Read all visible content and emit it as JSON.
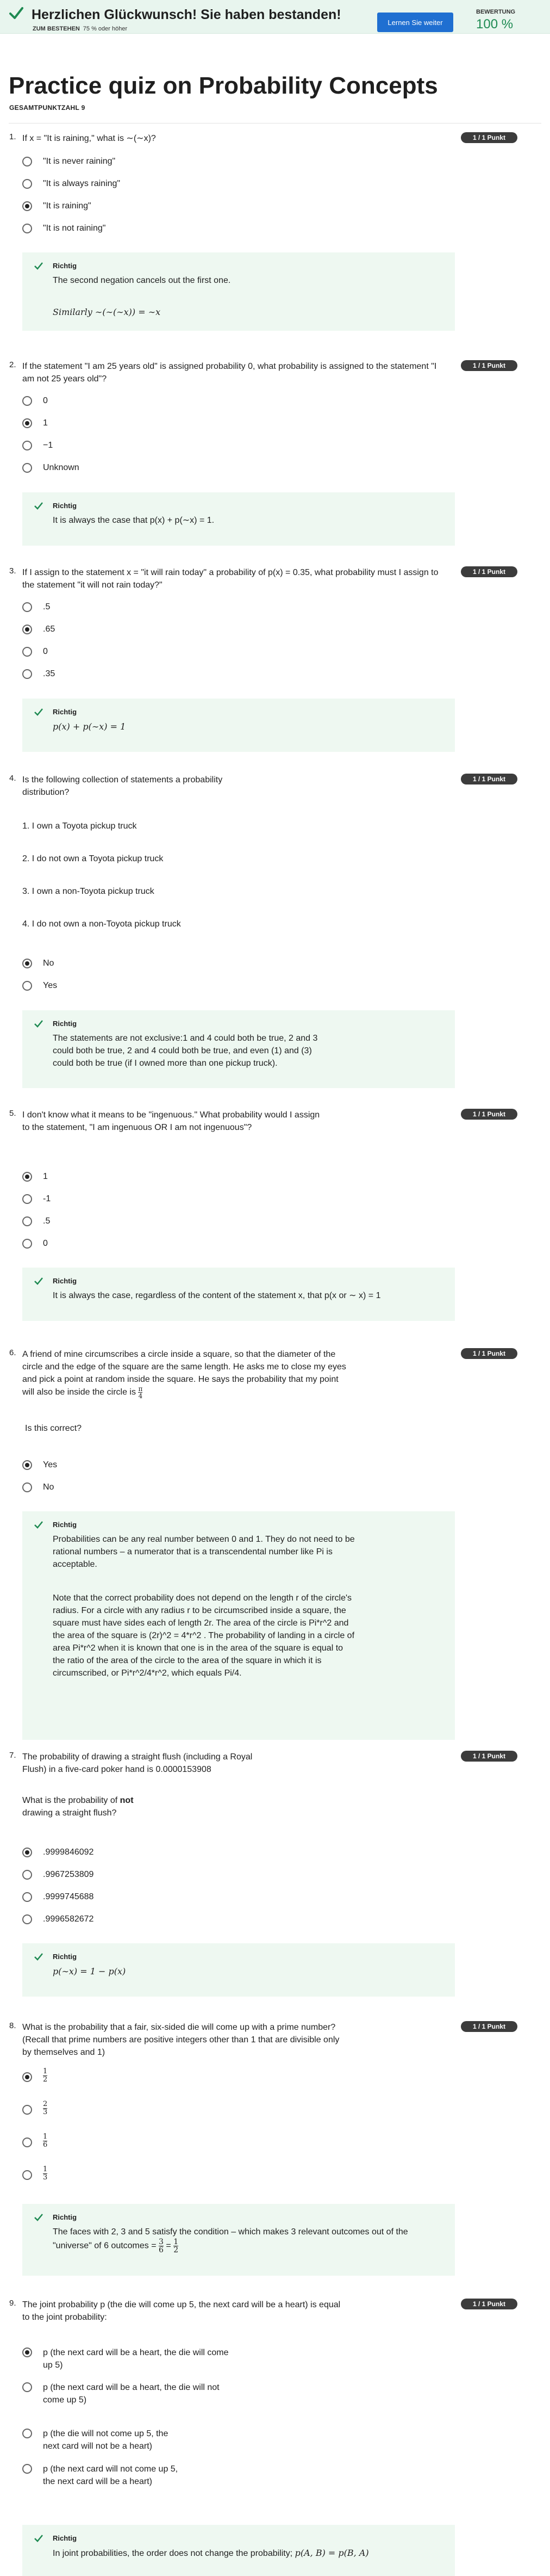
{
  "banner": {
    "title": "Herzlichen Glückwunsch! Sie haben bestanden!",
    "pass_label": "ZUM BESTEHEN",
    "pass_value": "75 % oder höher",
    "learn_button": "Lernen Sie weiter",
    "grade_label": "BEWERTUNG",
    "grade_value": "100 %"
  },
  "page": {
    "title": "Practice quiz on Probability Concepts",
    "total_points": "GESAMTPUNKTZAHL 9"
  },
  "questions": [
    {
      "num": "1.",
      "text": "If x = \"It is raining,\" what is ∼(∼x)?",
      "points": "1 / 1 Punkt",
      "options": [
        "\"It is never raining\"",
        "\"It is always raining\"",
        "\"It is raining\"",
        "\"It is not raining\""
      ],
      "selected": 2,
      "feedback_label": "Richtig",
      "feedback": [
        "The second negation cancels out the first one.",
        "Similarly ∼(∼(∼x)) = ∼x"
      ]
    },
    {
      "num": "2.",
      "text": "If the statement \"I am 25 years old\" is assigned probability 0, what probability is assigned to the statement \"I am not 25 years old\"?",
      "points": "1 / 1 Punkt",
      "options": [
        "0",
        "1",
        "−1",
        "Unknown"
      ],
      "selected": 1,
      "feedback_label": "Richtig",
      "feedback": [
        "It is always the case that p(x) + p(∼x) = 1."
      ]
    },
    {
      "num": "3.",
      "text": "If I assign to the statement x = \"it will rain today\" a probability of p(x) = 0.35, what probability must I assign to the statement \"it will not rain today?\"",
      "points": "1 / 1 Punkt",
      "options": [
        ".5",
        ".65",
        "0",
        ".35"
      ],
      "selected": 1,
      "feedback_label": "Richtig",
      "feedback": [
        "p(x) + p(∼x) = 1"
      ]
    },
    {
      "num": "4.",
      "text": "Is the following collection of statements a probability distribution?",
      "statements": [
        "1. I own a Toyota pickup truck",
        "2. I do not own a Toyota pickup truck",
        "3. I own a non-Toyota pickup truck",
        "4. I do not own a non-Toyota pickup truck"
      ],
      "points": "1 / 1 Punkt",
      "options": [
        "No",
        "Yes"
      ],
      "selected": 0,
      "feedback_label": "Richtig",
      "feedback": [
        "The statements are not exclusive:1 and 4 could both be true, 2 and 3 could both be true, 2 and 4 could both be true, and even (1) and (3) could both be true (if I owned more than one pickup truck)."
      ]
    },
    {
      "num": "5.",
      "text": "I don't know what it means to be \"ingenuous.\" What probability would I assign to the statement, \"I am ingenuous OR I am not ingenuous\"?",
      "points": "1 / 1 Punkt",
      "options": [
        "1",
        "-1",
        ".5",
        "0"
      ],
      "selected": 0,
      "feedback_label": "Richtig",
      "feedback": [
        "It is always the case, regardless of the content of the statement x, that p(x or ∼ x) = 1"
      ]
    },
    {
      "num": "6.",
      "text": "A friend of mine circumscribes a circle inside a square, so that the diameter of the circle and the edge of the square are the same length. He asks me to close my eyes and pick a point at random inside the square. He says the probability that my point will also be inside the circle is",
      "frac": [
        "π",
        "4"
      ],
      "text2": "Is this correct?",
      "points": "1 / 1 Punkt",
      "options": [
        "Yes",
        "No"
      ],
      "selected": 0,
      "feedback_label": "Richtig",
      "feedback": [
        "Probabilities can be any real number between 0 and 1. They do not need to be rational numbers – a numerator that is a transcendental number like Pi is acceptable.",
        "Note that the correct probability does not depend on the length r of the circle's radius. For a circle with any radius r to be circumscribed inside a square, the square must have sides each of length 2r. The area of the circle is Pi*r^2 and the area of the square is (2r)^2 = 4*r^2 . The probability of landing in a circle of area Pi*r^2 when it is known that one is in the area of the square is equal to the ratio of the area of the circle to the area of the square in which it is circumscribed, or Pi*r^2/4*r^2, which equals Pi/4."
      ]
    },
    {
      "num": "7.",
      "text": "The probability of drawing a straight flush (including a Royal Flush) in a five-card poker hand is 0.0000153908",
      "text2a": "What is the probability of",
      "text2b": "not",
      "text2c": "drawing a straight flush?",
      "points": "1 / 1 Punkt",
      "options": [
        ".9999846092",
        ".9967253809",
        ".9999745688",
        ".9996582672"
      ],
      "selected": 0,
      "feedback_label": "Richtig",
      "feedback": [
        "p(∼x) = 1 − p(x)"
      ]
    },
    {
      "num": "8.",
      "text": "What is the probability that a fair, six-sided die will come up with a prime number? (Recall that prime numbers are positive integers other than 1 that are divisible only by themselves and 1)",
      "points": "1 / 1 Punkt",
      "options": [
        [
          "1",
          "2"
        ],
        [
          "2",
          "3"
        ],
        [
          "1",
          "6"
        ],
        [
          "1",
          "3"
        ]
      ],
      "selected": 0,
      "feedback_label": "Richtig",
      "feedback": [
        "The faces with 2, 3 and 5 satisfy the condition – which makes 3 relevant outcomes out of the \"universe\" of 6 outcomes ="
      ],
      "feedback_frac": [
        [
          "3",
          "6"
        ],
        [
          "1",
          "2"
        ]
      ]
    },
    {
      "num": "9.",
      "text": "The joint probability p (the die will come up 5, the next card will be a heart) is equal to the joint probability:",
      "points": "1 / 1 Punkt",
      "options": [
        "p (the next card will be a heart, the die will come up 5)",
        "p (the next card will be a heart, the die will not come up 5)",
        "p (the die will not come up 5, the next card will not be a heart)",
        "p (the next card will not come up 5, the next card will be a heart)"
      ],
      "selected": 0,
      "feedback_label": "Richtig",
      "feedback": [
        "In joint probabilities, the order does not change the probability;",
        "p(A, B) = p(B, A)"
      ]
    }
  ],
  "colors": {
    "accent": "#1f6fd1",
    "success": "#1e8a52",
    "feedback_bg": "#eef8f1",
    "badge": "#3c3c3c"
  }
}
